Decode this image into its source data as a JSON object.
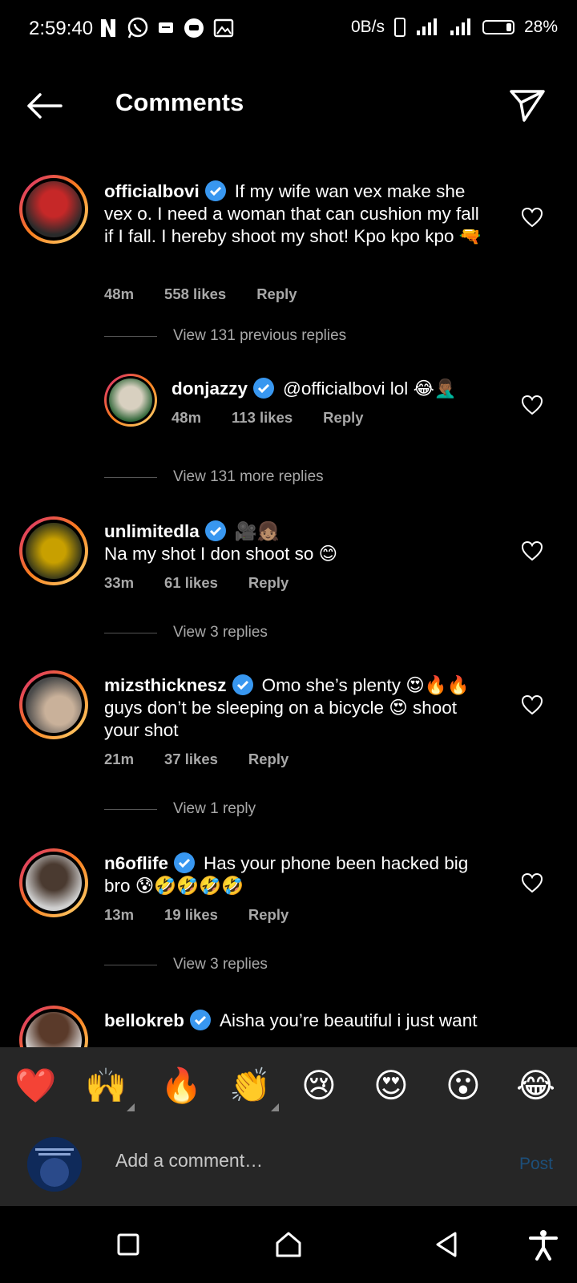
{
  "status_bar": {
    "time": "2:59:40",
    "speed": "0B/s",
    "battery": "28%"
  },
  "header": {
    "title": "Comments"
  },
  "comments": [
    {
      "user": "officialbovi",
      "text": "If my wife wan vex make she vex o. I need a woman that can cushion my fall if I fall. I hereby shoot my shot! Kpo kpo kpo 🔫",
      "time": "48m",
      "likes": "558 likes",
      "reply": "Reply"
    },
    {
      "user": "donjazzy",
      "text": "@officialbovi lol 😂🤦🏾‍♂️",
      "time": "48m",
      "likes": "113 likes",
      "reply": "Reply"
    },
    {
      "user": "unlimitedla",
      "text_line1": "🎥👧🏽",
      "text": "Na my shot I don shoot so 😊",
      "time": "33m",
      "likes": "61 likes",
      "reply": "Reply"
    },
    {
      "user": "mizsthicknesz",
      "text": "Omo she’s plenty 😍🔥🔥 guys don’t be sleeping on a bicycle 😍 shoot your shot",
      "time": "21m",
      "likes": "37 likes",
      "reply": "Reply"
    },
    {
      "user": "n6oflife",
      "text": "Has your phone been hacked big bro 😰🤣🤣🤣🤣",
      "time": "13m",
      "likes": "19 likes",
      "reply": "Reply"
    },
    {
      "user": "bellokreb",
      "text": "Aisha you’re beautiful i just want"
    }
  ],
  "view_replies": {
    "previous": "View 131 previous replies",
    "more": "View 131 more replies",
    "unlimitedla": "View 3 replies",
    "mizsthicknesz": "View 1 reply",
    "n6oflife": "View 3 replies"
  },
  "emoji_bar": [
    "❤️",
    "🙌",
    "🔥",
    "👏",
    "😢",
    "😍",
    "😮",
    "😂"
  ],
  "composer": {
    "placeholder": "Add a comment…",
    "post_label": "Post"
  },
  "colors": {
    "background": "#000000",
    "muted_text": "#a8a8a8",
    "verified": "#3897f0",
    "post_disabled": "#1d4f7a"
  }
}
